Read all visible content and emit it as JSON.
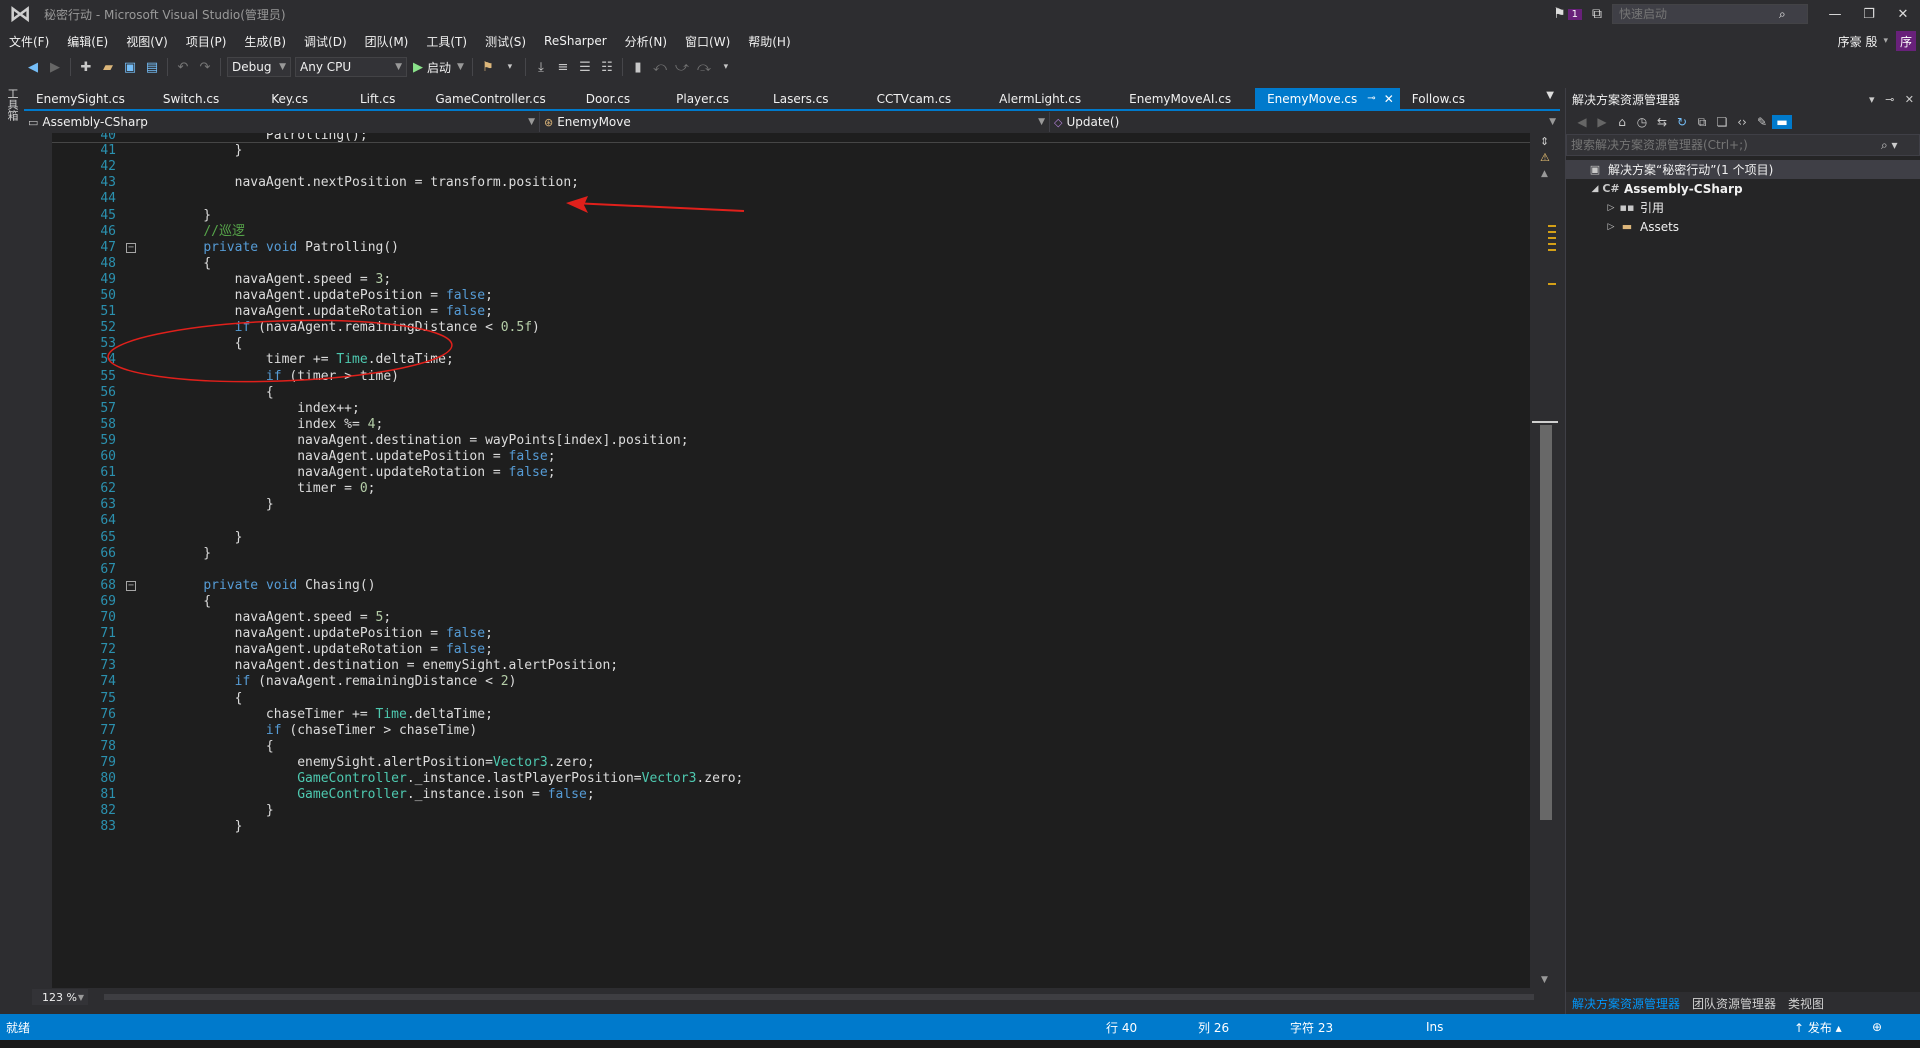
{
  "window": {
    "title": "秘密行动 - Microsoft Visual Studio(管理员)",
    "notification_count": "1",
    "quick_launch_placeholder": "快速启动"
  },
  "menu": [
    {
      "label": "文件(F)"
    },
    {
      "label": "编辑(E)"
    },
    {
      "label": "视图(V)"
    },
    {
      "label": "项目(P)"
    },
    {
      "label": "生成(B)"
    },
    {
      "label": "调试(D)"
    },
    {
      "label": "团队(M)"
    },
    {
      "label": "工具(T)"
    },
    {
      "label": "测试(S)"
    },
    {
      "label": "ReSharper"
    },
    {
      "label": "分析(N)"
    },
    {
      "label": "窗口(W)"
    },
    {
      "label": "帮助(H)"
    }
  ],
  "user": {
    "name": "序豪 殷",
    "initial": "序"
  },
  "toolbar": {
    "config": "Debug",
    "platform": "Any CPU",
    "start_label": "启动"
  },
  "left_strip": {
    "toolbox_label": "工具箱"
  },
  "tabs": [
    {
      "label": "EnemySight.cs"
    },
    {
      "label": "Switch.cs"
    },
    {
      "label": "Key.cs"
    },
    {
      "label": "Lift.cs"
    },
    {
      "label": "GameController.cs"
    },
    {
      "label": "Door.cs"
    },
    {
      "label": "Player.cs"
    },
    {
      "label": "Lasers.cs"
    },
    {
      "label": "CCTVcam.cs"
    },
    {
      "label": "AlermLight.cs"
    },
    {
      "label": "EnemyMoveAI.cs"
    },
    {
      "label": "EnemyMove.cs",
      "active": true
    },
    {
      "label": "Follow.cs"
    }
  ],
  "navbar": {
    "project": "Assembly-CSharp",
    "class": "EnemyMove",
    "member": "Update()"
  },
  "code_lines": [
    {
      "n": "40",
      "text": "            Patrolling();",
      "current": true
    },
    {
      "n": "41",
      "text": "        }"
    },
    {
      "n": "42",
      "text": ""
    },
    {
      "n": "43",
      "text": "        navaAgent.nextPosition = transform.position;"
    },
    {
      "n": "44",
      "text": ""
    },
    {
      "n": "45",
      "text": "    }"
    },
    {
      "n": "46",
      "text": "    //巡逻"
    },
    {
      "n": "47",
      "text": "    private void Patrolling()",
      "fold": true
    },
    {
      "n": "48",
      "text": "    {"
    },
    {
      "n": "49",
      "text": "        navaAgent.speed = 3;"
    },
    {
      "n": "50",
      "text": "        navaAgent.updatePosition = false;"
    },
    {
      "n": "51",
      "text": "        navaAgent.updateRotation = false;"
    },
    {
      "n": "52",
      "text": "        if (navaAgent.remainingDistance < 0.5f)"
    },
    {
      "n": "53",
      "text": "        {"
    },
    {
      "n": "54",
      "text": "            timer += Time.deltaTime;"
    },
    {
      "n": "55",
      "text": "            if (timer > time)"
    },
    {
      "n": "56",
      "text": "            {"
    },
    {
      "n": "57",
      "text": "                index++;"
    },
    {
      "n": "58",
      "text": "                index %= 4;"
    },
    {
      "n": "59",
      "text": "                navaAgent.destination = wayPoints[index].position;"
    },
    {
      "n": "60",
      "text": "                navaAgent.updatePosition = false;"
    },
    {
      "n": "61",
      "text": "                navaAgent.updateRotation = false;"
    },
    {
      "n": "62",
      "text": "                timer = 0;"
    },
    {
      "n": "63",
      "text": "            }"
    },
    {
      "n": "64",
      "text": ""
    },
    {
      "n": "65",
      "text": "        }"
    },
    {
      "n": "66",
      "text": "    }"
    },
    {
      "n": "67",
      "text": ""
    },
    {
      "n": "68",
      "text": "    private void Chasing()",
      "fold": true
    },
    {
      "n": "69",
      "text": "    {"
    },
    {
      "n": "70",
      "text": "        navaAgent.speed = 5;"
    },
    {
      "n": "71",
      "text": "        navaAgent.updatePosition = false;"
    },
    {
      "n": "72",
      "text": "        navaAgent.updateRotation = false;"
    },
    {
      "n": "73",
      "text": "        navaAgent.destination = enemySight.alertPosition;"
    },
    {
      "n": "74",
      "text": "        if (navaAgent.remainingDistance < 2)"
    },
    {
      "n": "75",
      "text": "        {"
    },
    {
      "n": "76",
      "text": "            chaseTimer += Time.deltaTime;"
    },
    {
      "n": "77",
      "text": "            if (chaseTimer > chaseTime)"
    },
    {
      "n": "78",
      "text": "            {"
    },
    {
      "n": "79",
      "text": "                enemySight.alertPosition=Vector3.zero;"
    },
    {
      "n": "80",
      "text": "                GameController._instance.lastPlayerPosition=Vector3.zero;"
    },
    {
      "n": "81",
      "text": "                GameController._instance.ison = false;"
    },
    {
      "n": "82",
      "text": "            }"
    },
    {
      "n": "83",
      "text": "        }"
    }
  ],
  "editor": {
    "zoom": "123 %"
  },
  "solution_explorer": {
    "title": "解决方案资源管理器",
    "search_placeholder": "搜索解决方案资源管理器(Ctrl+;)",
    "tree": [
      {
        "label": "解决方案“秘密行动”(1 个项目)",
        "level": 0,
        "toggle": "",
        "icon": "solution-icon",
        "glyph": "▣",
        "selected": true
      },
      {
        "label": "Assembly-CSharp",
        "level": 1,
        "toggle": "◢",
        "icon": "csharp-project-icon",
        "glyph": "C#",
        "bold": true
      },
      {
        "label": "引用",
        "level": 2,
        "toggle": "▷",
        "icon": "references-icon",
        "glyph": "▪▪"
      },
      {
        "label": "Assets",
        "level": 2,
        "toggle": "▷",
        "icon": "folder-icon",
        "glyph": "▬"
      }
    ],
    "bottom_tabs": [
      {
        "label": "解决方案资源管理器",
        "active": true
      },
      {
        "label": "团队资源管理器"
      },
      {
        "label": "类视图"
      }
    ]
  },
  "status": {
    "ready": "就绪",
    "row": "行 40",
    "col": "列 26",
    "char": "字符 23",
    "mode": "Ins",
    "publish": "↑ 发布 ▴"
  },
  "colors": {
    "accent": "#007acc",
    "editor_bg": "#1e1e1e",
    "keyword": "#569cd6",
    "type": "#4ec9b0",
    "comment": "#57a64a",
    "line_number": "#2b91af",
    "annotation": "#e0201b"
  }
}
